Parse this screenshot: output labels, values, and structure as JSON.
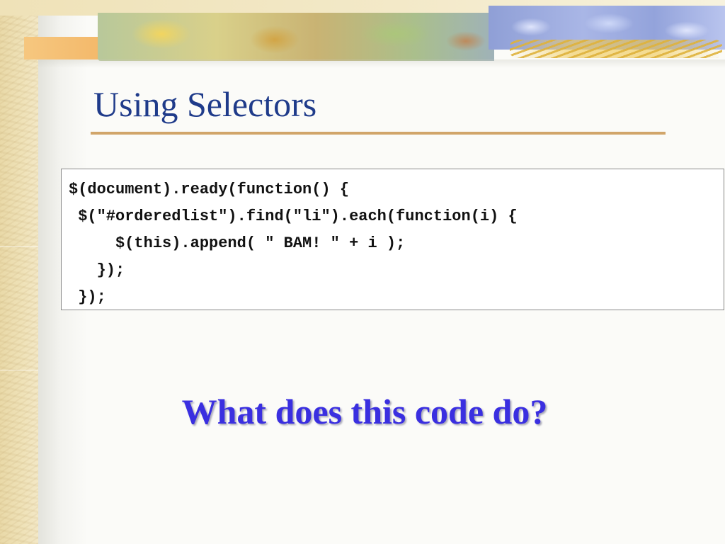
{
  "slide": {
    "title": "Using Selectors",
    "code_lines": [
      "$(document).ready(function() {",
      " $(\"#orderedlist\").find(\"li\").each(function(i) {",
      "     $(this).append( \" BAM! \" + i );",
      "   });",
      " });"
    ],
    "question": "What does this code do?"
  },
  "colors": {
    "title": "#1f3b8a",
    "title_rule": "#d1a56a",
    "question": "#3a2fe0",
    "code_text": "#111111",
    "code_border": "#8a8a8a"
  },
  "decoration": {
    "banner": "autumn-leaves-banner",
    "left_band": "parchment-texture"
  }
}
